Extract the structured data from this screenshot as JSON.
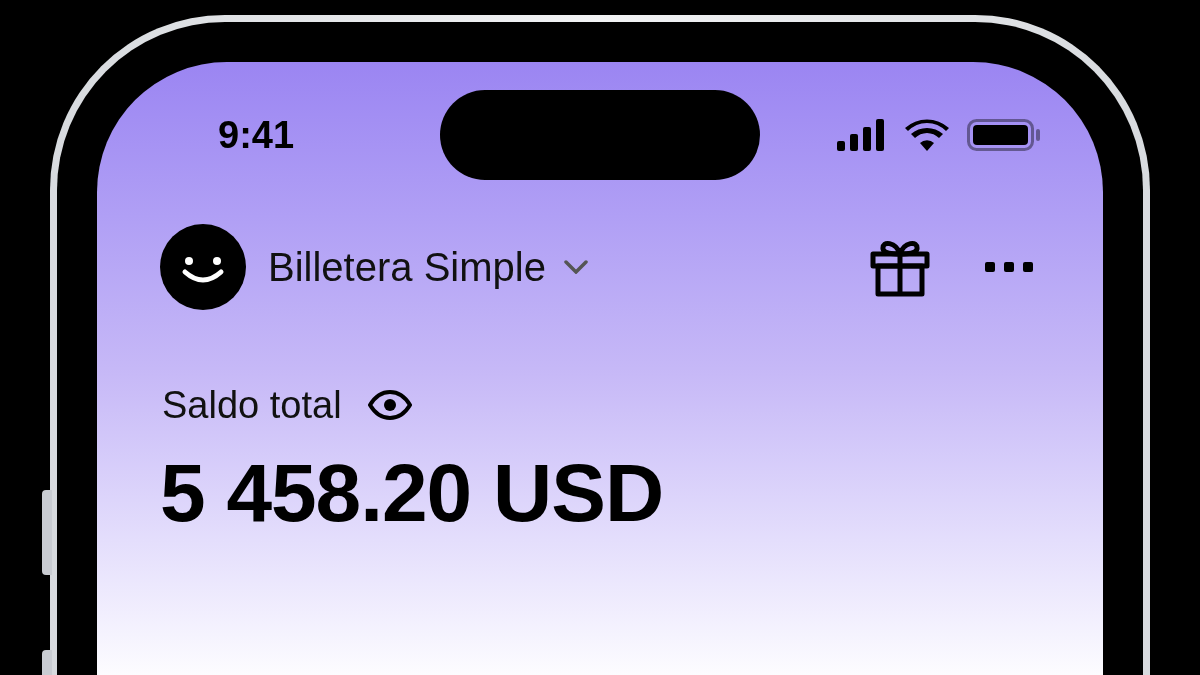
{
  "status_bar": {
    "time": "9:41"
  },
  "header": {
    "wallet_name": "Billetera Simple"
  },
  "balance": {
    "label": "Saldo total",
    "amount": "5 458.20 USD"
  }
}
